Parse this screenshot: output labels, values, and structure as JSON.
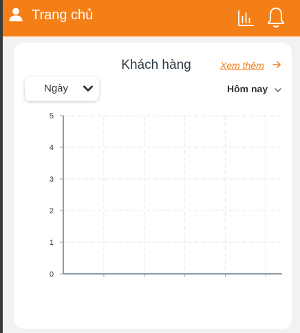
{
  "header": {
    "title": "Trang chủ",
    "brand_color": "#f57f17",
    "icons": [
      "user-icon",
      "bar-chart-icon",
      "bell-icon"
    ]
  },
  "card": {
    "title": "Khách hàng",
    "see_more_label": "Xem thêm",
    "period_dropdown": {
      "selected": "Ngày"
    },
    "range_select": {
      "selected": "Hôm nay"
    }
  },
  "chart_data": {
    "type": "bar",
    "categories": [],
    "values": [],
    "title": "",
    "xlabel": "",
    "ylabel": "",
    "ylim": [
      0,
      5
    ],
    "y_ticks": [
      "0",
      "1",
      "2",
      "3",
      "4",
      "5"
    ],
    "grid": true,
    "grid_style": "dashed"
  }
}
